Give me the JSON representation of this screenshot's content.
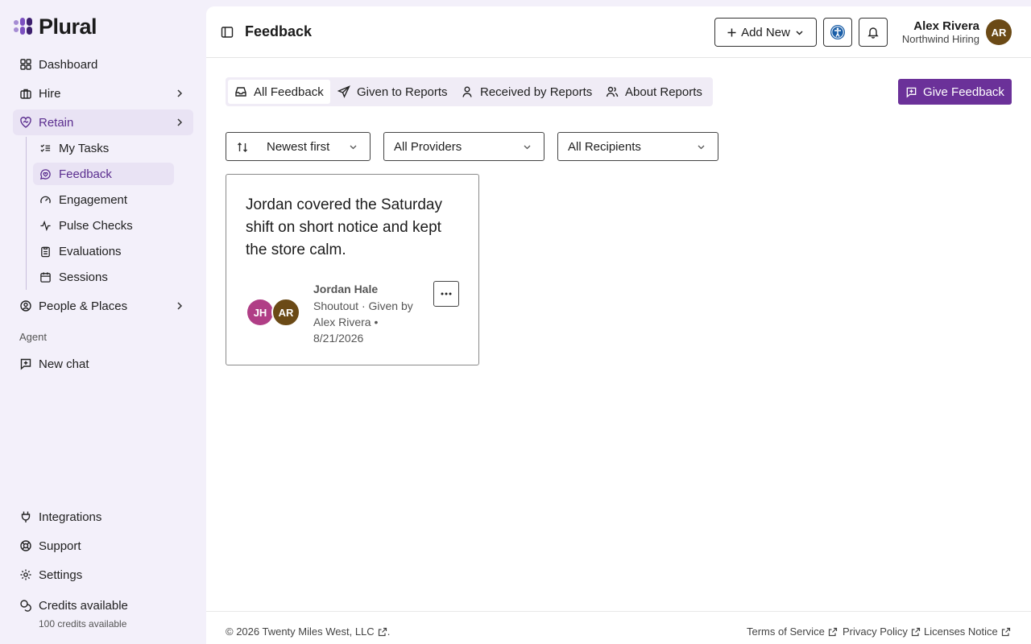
{
  "brand": {
    "name": "Plural",
    "accent": "#6b3199"
  },
  "sidebar": {
    "items": [
      {
        "label": "Dashboard",
        "icon": "grid-icon"
      },
      {
        "label": "Hire",
        "icon": "briefcase-icon"
      },
      {
        "label": "Retain",
        "icon": "heart-handshake-icon"
      },
      {
        "label": "People & Places",
        "icon": "user-circle-icon"
      }
    ],
    "sub_items": [
      {
        "label": "My Tasks",
        "icon": "list-checks-icon"
      },
      {
        "label": "Feedback",
        "icon": "message-heart-icon"
      },
      {
        "label": "Engagement",
        "icon": "gauge-icon"
      },
      {
        "label": "Pulse Checks",
        "icon": "activity-icon"
      },
      {
        "label": "Evaluations",
        "icon": "clipboard-icon"
      },
      {
        "label": "Sessions",
        "icon": "calendar-icon"
      }
    ],
    "agent_label": "Agent",
    "new_chat": "New chat",
    "bottom": [
      {
        "label": "Integrations",
        "icon": "plug-icon"
      },
      {
        "label": "Support",
        "icon": "life-buoy-icon"
      },
      {
        "label": "Settings",
        "icon": "gear-icon"
      },
      {
        "label": "Credits available",
        "icon": "coins-icon"
      }
    ],
    "credits_sub": "100 credits available"
  },
  "header": {
    "title": "Feedback",
    "add_new": "Add New",
    "user": {
      "name": "Alex Rivera",
      "org": "Northwind Hiring",
      "initials": "AR"
    }
  },
  "tabs": [
    {
      "label": "All Feedback",
      "icon": "inbox-icon"
    },
    {
      "label": "Given to Reports",
      "icon": "send-icon"
    },
    {
      "label": "Received by Reports",
      "icon": "user-icon"
    },
    {
      "label": "About Reports",
      "icon": "users-icon"
    }
  ],
  "give_feedback": "Give Feedback",
  "filters": {
    "sort": "Newest first",
    "providers": "All Providers",
    "recipients": "All Recipients"
  },
  "feedback_cards": [
    {
      "text": "Jordan covered the Saturday shift on short notice and kept the store calm.",
      "recipient": "Jordan Hale",
      "recipient_initials": "JH",
      "giver_initials": "AR",
      "meta": "Shoutout · Given by Alex Rivera • 8/21/2026"
    }
  ],
  "footer": {
    "copyright": "© 2026 Twenty Miles West, LLC",
    "copyright_suffix": ".",
    "links": [
      "Terms of Service",
      "Privacy Policy",
      "Licenses Notice"
    ]
  }
}
